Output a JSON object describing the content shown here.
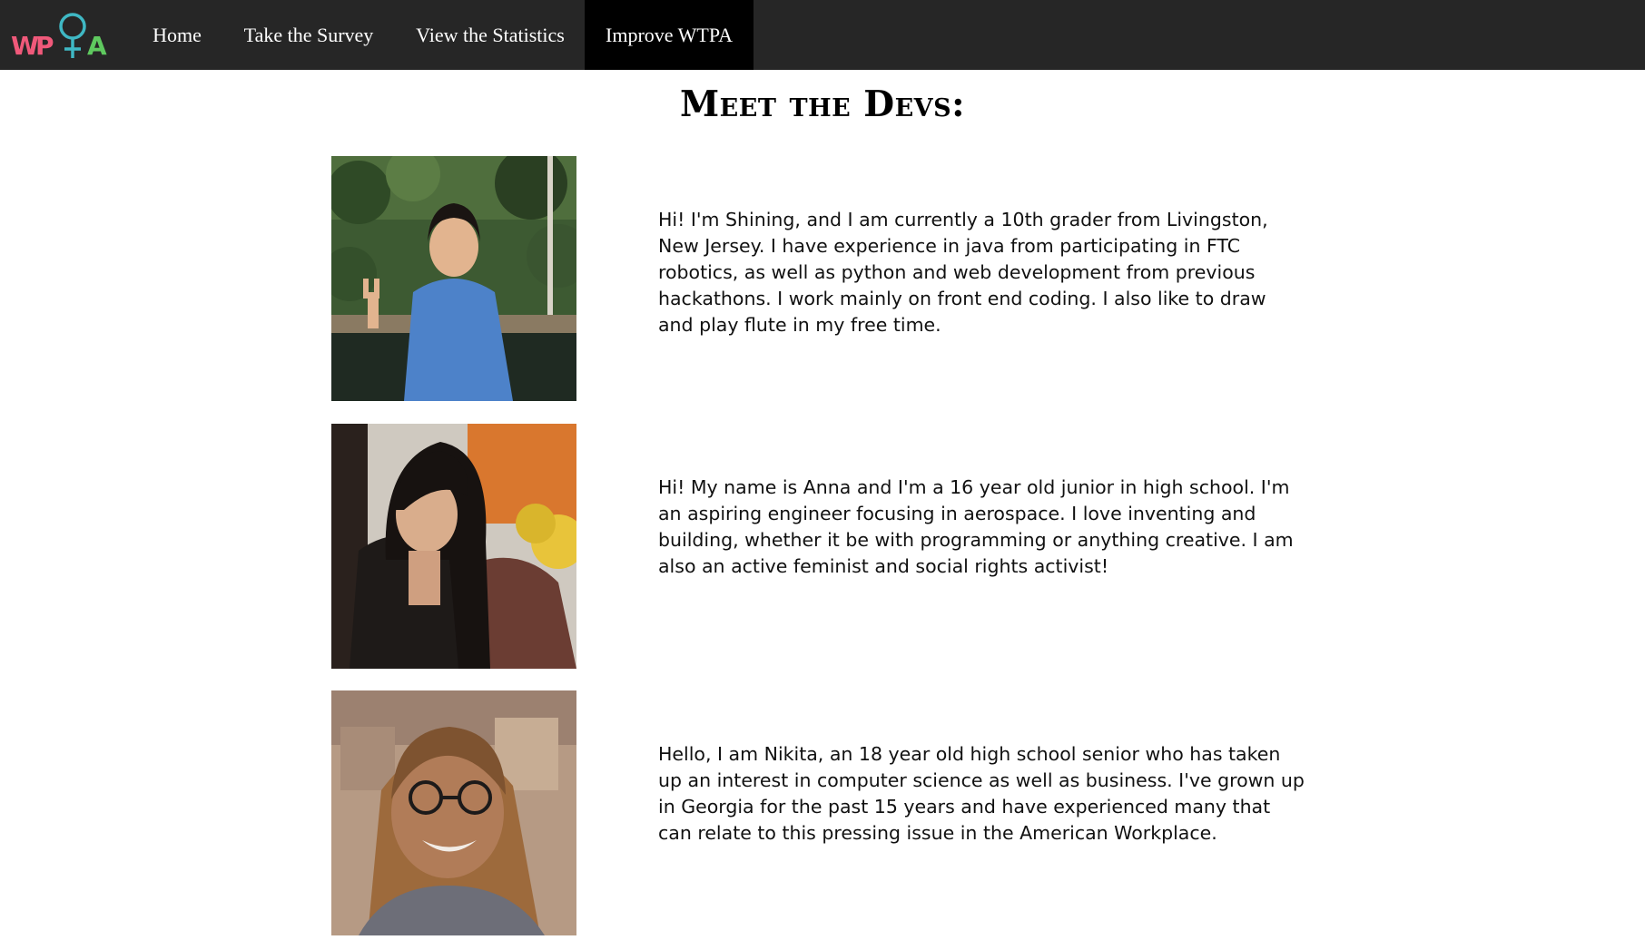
{
  "nav": {
    "logo_text": "WPTA",
    "items": [
      {
        "label": "Home"
      },
      {
        "label": "Take the Survey"
      },
      {
        "label": "View the Statistics"
      },
      {
        "label": "Improve WTPA",
        "active": true
      }
    ]
  },
  "page": {
    "title": "Meet the Devs:"
  },
  "devs": [
    {
      "bio": "Hi! I'm Shining, and I am currently a 10th grader from Livingston, New Jersey. I have experience in java from participating in FTC robotics, as well as python and web development from previous hackathons. I work mainly on front end coding. I also like to draw and play flute in my free time."
    },
    {
      "bio": "Hi! My name is Anna and I'm a 16 year old junior in high school. I'm an aspiring engineer focusing in aerospace. I love inventing and building, whether it be with programming or anything creative. I am also an active feminist and social rights activist!"
    },
    {
      "bio": "Hello, I am Nikita, an 18 year old high school senior who has taken up an interest in computer science as well as business. I've grown up in Georgia for the past 15 years and have experienced many that can relate to this pressing issue in the American Workplace."
    }
  ],
  "colors": {
    "navbar_bg": "#262626",
    "active_nav_bg": "#000000",
    "logo_pink": "#f0597a",
    "logo_teal": "#3fb8c4",
    "logo_green": "#5fc95f"
  }
}
